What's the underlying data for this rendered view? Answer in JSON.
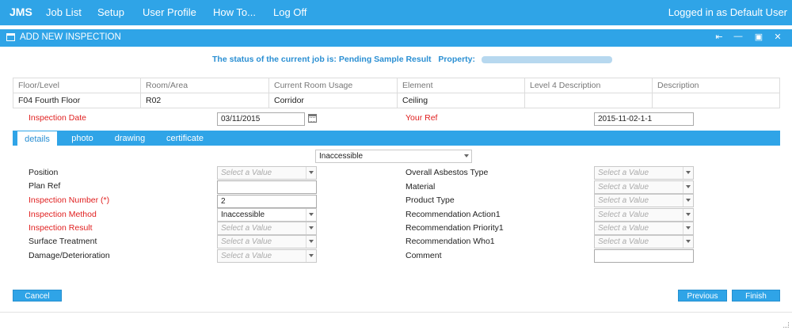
{
  "topnav": {
    "brand": "JMS",
    "items": [
      "Job List",
      "Setup",
      "User Profile",
      "How To...",
      "Log Off"
    ],
    "user_text": "Logged in as Default User"
  },
  "window": {
    "title": "ADD NEW INSPECTION",
    "controls": [
      "restore-icon",
      "minimize-icon",
      "maximize-icon",
      "close-icon"
    ]
  },
  "status": {
    "text": "The status of the current job is: Pending Sample Result",
    "property_label": "Property:"
  },
  "location_table": {
    "headers": [
      "Floor/Level",
      "Room/Area",
      "Current Room Usage",
      "Element",
      "Level 4 Description",
      "Description"
    ],
    "row": [
      "F04 Fourth Floor",
      "R02",
      "Corridor",
      "Ceiling",
      "",
      ""
    ]
  },
  "inspection": {
    "date_label": "Inspection Date",
    "date_value": "03/11/2015",
    "your_ref_label": "Your Ref",
    "your_ref_value": "2015-11-02-1-1"
  },
  "tabs": [
    "details",
    "photo",
    "drawing",
    "certificate"
  ],
  "details": {
    "top_select": "Inaccessible",
    "placeholder": "Select a Value",
    "left_labels": [
      "Position",
      "Plan Ref",
      "Inspection Number (*)",
      "Inspection Method",
      "Inspection Result",
      "Surface Treatment",
      "Damage/Deterioration"
    ],
    "plan_ref_value": "",
    "inspection_number_value": "2",
    "inspection_method_value": "Inaccessible",
    "right_labels": [
      "Overall Asbestos Type",
      "Material",
      "Product Type",
      "Recommendation Action1",
      "Recommendation Priority1",
      "Recommendation Who1",
      "Comment"
    ],
    "comment_value": ""
  },
  "buttons": {
    "cancel": "Cancel",
    "previous": "Previous",
    "finish": "Finish"
  },
  "colors": {
    "accent": "#2fa4e7",
    "required": "#e02020",
    "status": "#2a8fd3"
  }
}
